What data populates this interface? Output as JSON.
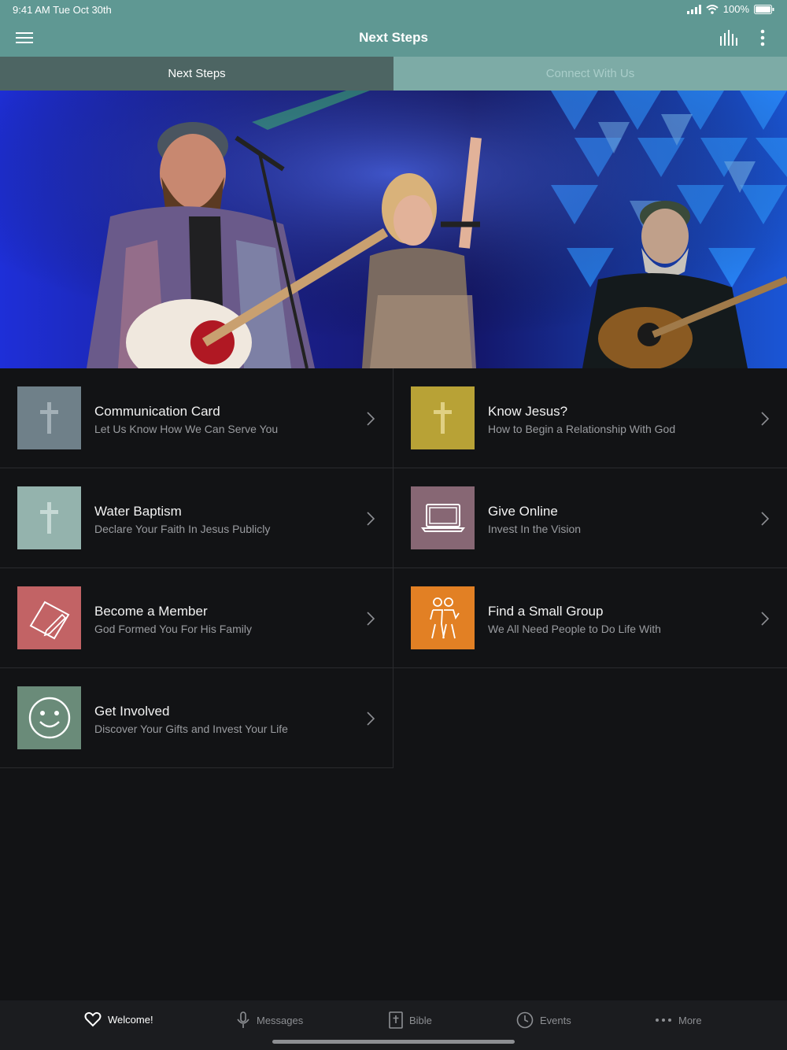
{
  "status": {
    "time": "9:41 AM   Tue Oct 30th",
    "battery": "100%"
  },
  "navbar": {
    "title": "Next Steps"
  },
  "tabs": [
    {
      "label": "Next Steps"
    },
    {
      "label": "Connect With Us"
    }
  ],
  "items": [
    {
      "title": "Communication Card",
      "subtitle": "Let Us Know How We Can Serve You",
      "color": "#6f8089",
      "icon": "cross-icon"
    },
    {
      "title": "Know Jesus?",
      "subtitle": "How to Begin a Relationship With God",
      "color": "#b8a236",
      "icon": "cross-icon"
    },
    {
      "title": "Water Baptism",
      "subtitle": "Declare Your Faith In Jesus Publicly",
      "color": "#94b3ad",
      "icon": "cross-icon"
    },
    {
      "title": "Give Online",
      "subtitle": "Invest In the Vision",
      "color": "#876774",
      "icon": "laptop-icon"
    },
    {
      "title": "Become a Member",
      "subtitle": "God Formed You For His Family",
      "color": "#c26365",
      "icon": "pen-paper-icon"
    },
    {
      "title": "Find a Small Group",
      "subtitle": "We All Need People to Do Life With",
      "color": "#e28024",
      "icon": "people-icon"
    },
    {
      "title": "Get Involved",
      "subtitle": "Discover Your Gifts and Invest Your Life",
      "color": "#6a8b79",
      "icon": "smiley-icon"
    }
  ],
  "bottom": [
    {
      "label": "Welcome!",
      "icon": "heart-icon"
    },
    {
      "label": "Messages",
      "icon": "microphone-icon"
    },
    {
      "label": "Bible",
      "icon": "bible-icon"
    },
    {
      "label": "Events",
      "icon": "clock-icon"
    },
    {
      "label": "More",
      "icon": "more-dots-icon"
    }
  ]
}
